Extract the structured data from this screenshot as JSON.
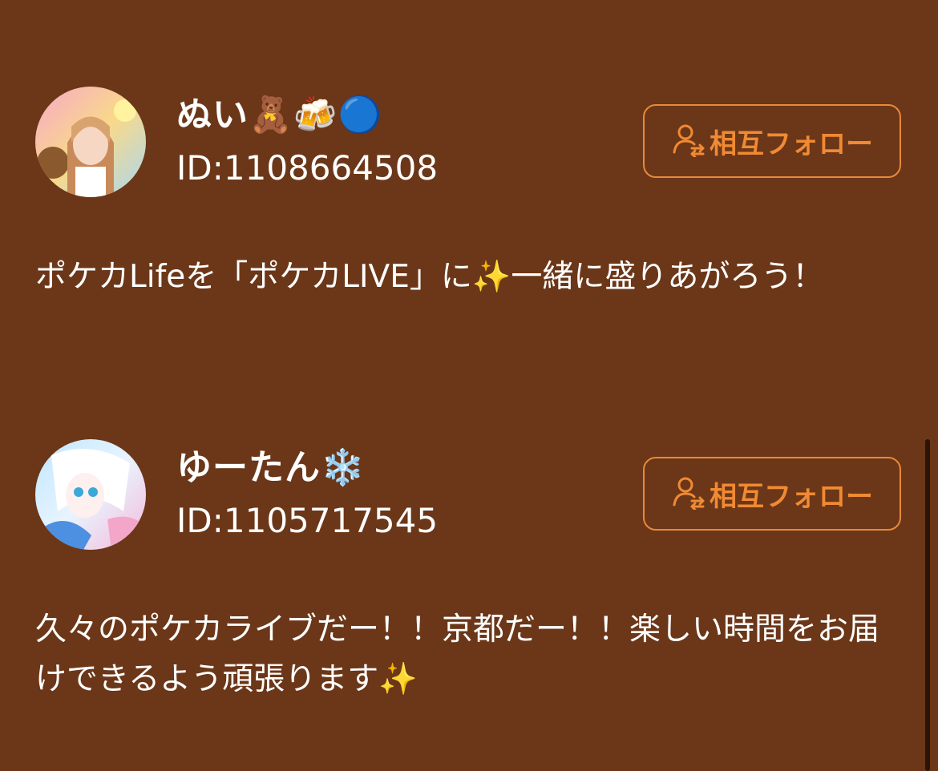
{
  "users": [
    {
      "name": "ぬい🧸🍻🔵",
      "id": "ID:1108664508",
      "follow_label": "相互フォロー",
      "bio": "ポケカLifeを「ポケカLIVE」に✨一緒に盛りあがろう！"
    },
    {
      "name": "ゆーたん❄️",
      "id": "ID:1105717545",
      "follow_label": "相互フォロー",
      "bio": "久々のポケカライブだー！！京都だー！！楽しい時間をお届けできるよう頑張ります✨"
    }
  ],
  "icons": {
    "follow_icon": "mutual-follow-user-icon"
  },
  "colors": {
    "background": "#6b3718",
    "accent": "#f08a33",
    "text": "#ffffff"
  }
}
